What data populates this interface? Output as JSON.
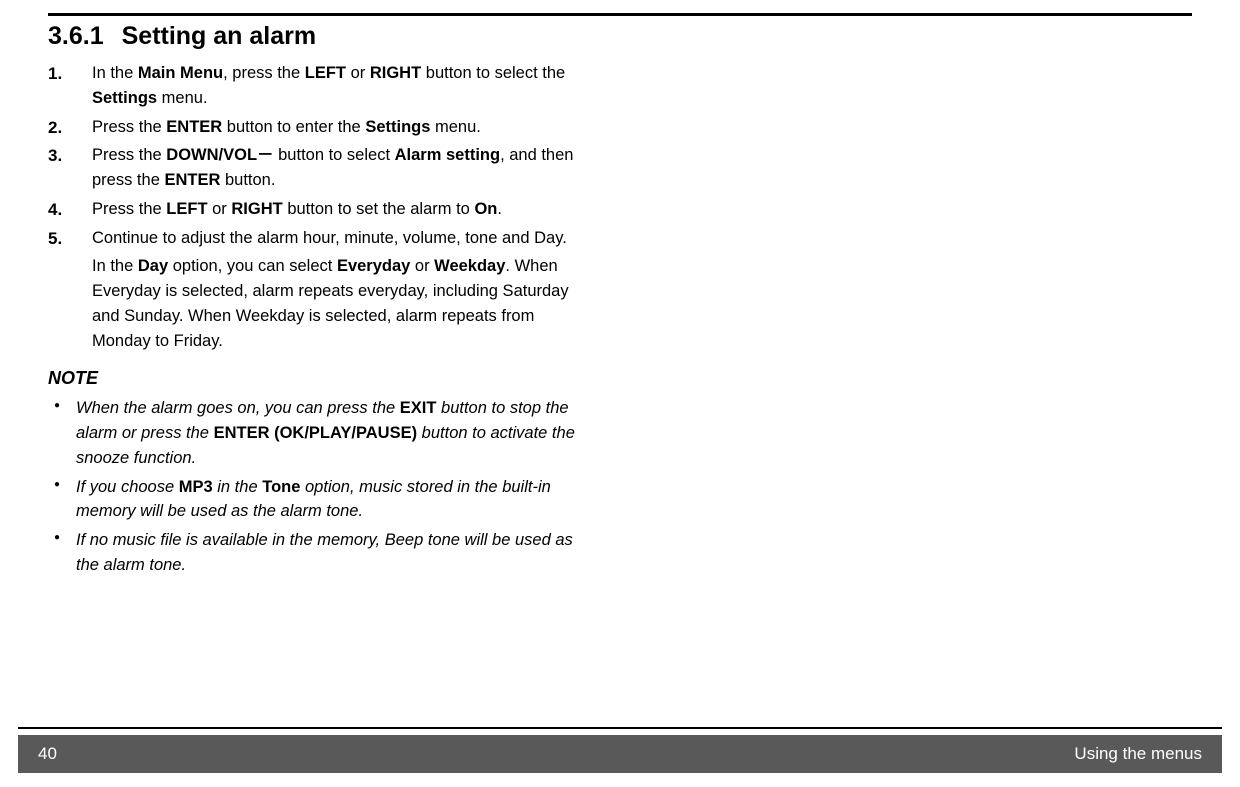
{
  "heading": {
    "number": "3.6.1",
    "title": "Setting an alarm"
  },
  "steps": [
    {
      "n": "1.",
      "html": "In the <b>Main Menu</b>, press the <b>LEFT</b> or <b>RIGHT</b> button to select the <b>Settings</b> menu."
    },
    {
      "n": "2.",
      "html": "Press the <b>ENTER</b> button to enter the <b>Settings</b> menu."
    },
    {
      "n": "3.",
      "html": "Press the <b>DOWN/VOL－</b> button to select <b>Alarm setting</b>, and then press the <b>ENTER</b> button."
    },
    {
      "n": "4.",
      "html": "Press the <b>LEFT</b> or <b>RIGHT</b> button to set the alarm to <b>On</b>."
    },
    {
      "n": "5.",
      "html": "Continue to adjust the alarm hour, minute, volume, tone and Day.",
      "extra": "In the <b>Day</b> option, you can select <b>Everyday</b> or <b>Weekday</b>. When Everyday is selected, alarm repeats everyday, including Saturday and Sunday. When Weekday is selected, alarm repeats from Monday to Friday."
    }
  ],
  "note_label": "NOTE",
  "notes": [
    "When the alarm goes on, you can press the <b>EXIT</b> button to stop the alarm or press the <b>ENTER (OK/PLAY/PAUSE)</b> button to activate the snooze function.",
    "If you choose <b>MP3</b> in the <b>Tone</b> option, music stored in the built-in memory will be used as the alarm tone.",
    "If no music file is available in the memory, Beep tone will be used as the alarm tone."
  ],
  "footer": {
    "page_number": "40",
    "section": "Using the menus"
  }
}
